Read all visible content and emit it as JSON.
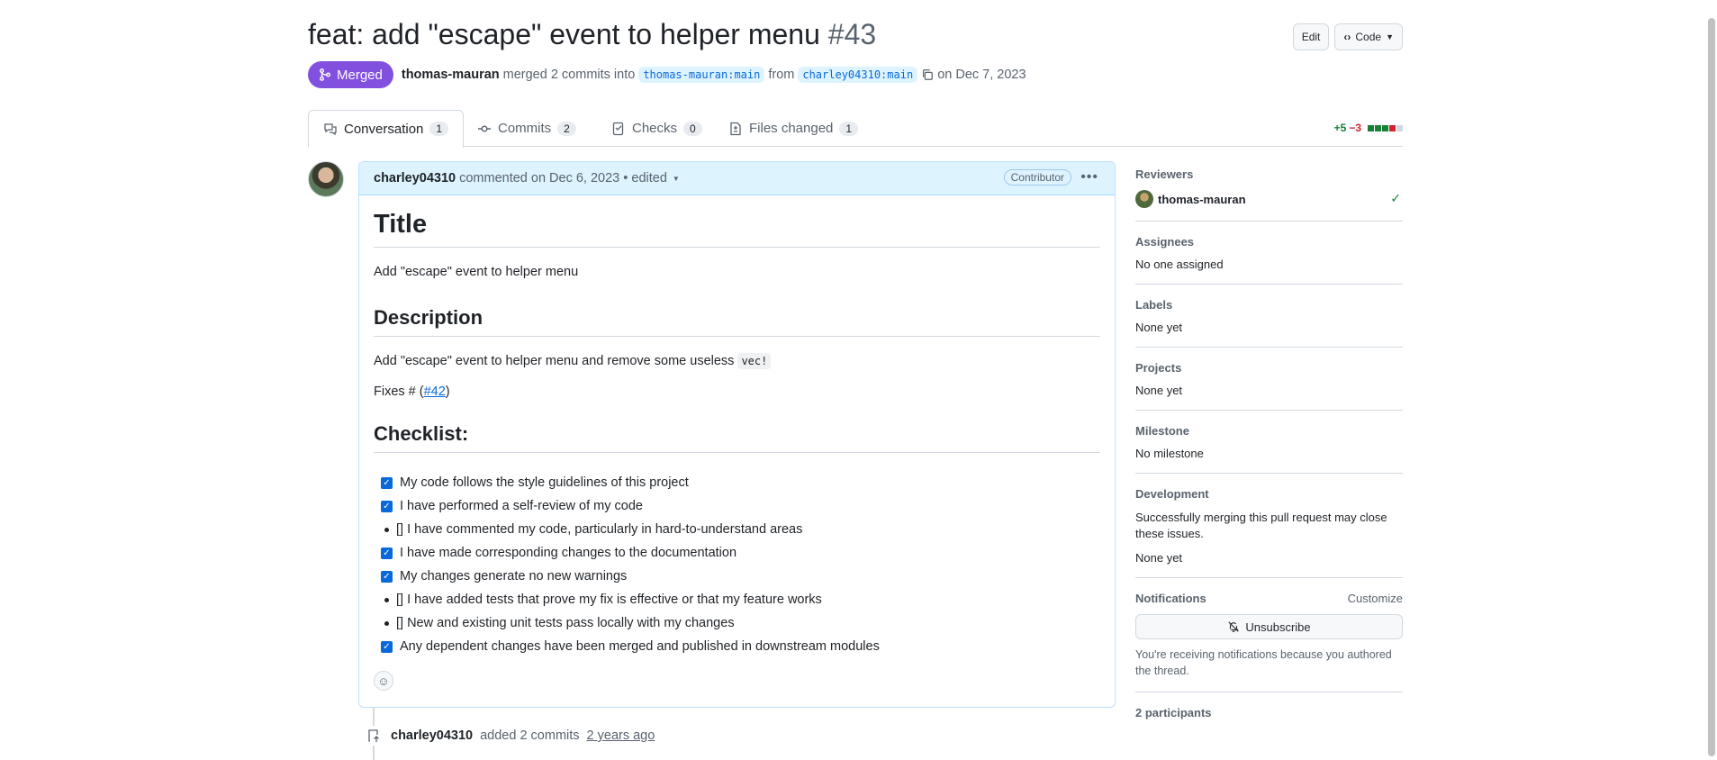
{
  "header": {
    "title": "feat: add \"escape\" event to helper menu",
    "number": "#43",
    "edit_label": "Edit",
    "code_label": "Code"
  },
  "state": {
    "badge": "Merged",
    "author": "thomas-mauran",
    "merged_text": "merged 2 commits into",
    "base_branch": "thomas-mauran:main",
    "from_text": "from",
    "head_branch": "charley04310:main",
    "date": "on Dec 7, 2023"
  },
  "tabs": [
    {
      "label": "Conversation",
      "count": "1"
    },
    {
      "label": "Commits",
      "count": "2"
    },
    {
      "label": "Checks",
      "count": "0"
    },
    {
      "label": "Files changed",
      "count": "1"
    }
  ],
  "diffstat": {
    "additions": "+5",
    "deletions": "−3"
  },
  "comment": {
    "author": "charley04310",
    "meta": "commented on Dec 6, 2023 • edited",
    "role": "Contributor",
    "title_heading": "Title",
    "title_text": "Add \"escape\" event to helper menu",
    "description_heading": "Description",
    "description_text": "Add \"escape\" event to helper menu and remove some useless",
    "description_code": "vec!",
    "fixes_prefix": "Fixes # (",
    "fixes_link": "#42",
    "fixes_suffix": ")",
    "checklist_heading": "Checklist:",
    "checklist": [
      {
        "text": "My code follows the style guidelines of this project",
        "checked": true
      },
      {
        "text": "I have performed a self-review of my code",
        "checked": true
      },
      {
        "text": "[] I have commented my code, particularly in hard-to-understand areas",
        "checked": false
      },
      {
        "text": "I have made corresponding changes to the documentation",
        "checked": true
      },
      {
        "text": "My changes generate no new warnings",
        "checked": true
      },
      {
        "text": "[] I have added tests that prove my fix is effective or that my feature works",
        "checked": false
      },
      {
        "text": "[] New and existing unit tests pass locally with my changes",
        "checked": false
      },
      {
        "text": "Any dependent changes have been merged and published in downstream modules",
        "checked": true
      }
    ]
  },
  "commit_event": {
    "author": "charley04310",
    "text": "added 2 commits",
    "time": "2 years ago"
  },
  "sidebar": {
    "reviewers_heading": "Reviewers",
    "reviewer": "thomas-mauran",
    "assignees_heading": "Assignees",
    "assignees_value": "No one assigned",
    "labels_heading": "Labels",
    "labels_value": "None yet",
    "projects_heading": "Projects",
    "projects_value": "None yet",
    "milestone_heading": "Milestone",
    "milestone_value": "No milestone",
    "development_heading": "Development",
    "development_note": "Successfully merging this pull request may close these issues.",
    "development_value": "None yet",
    "notifications_heading": "Notifications",
    "customize_label": "Customize",
    "unsubscribe_label": "Unsubscribe",
    "notifications_note": "You're receiving notifications because you authored the thread.",
    "participants_heading": "2 participants"
  },
  "colors": {
    "merged": "#8250df",
    "link": "#0969da",
    "addition": "#1a7f37",
    "deletion": "#d1242f"
  }
}
